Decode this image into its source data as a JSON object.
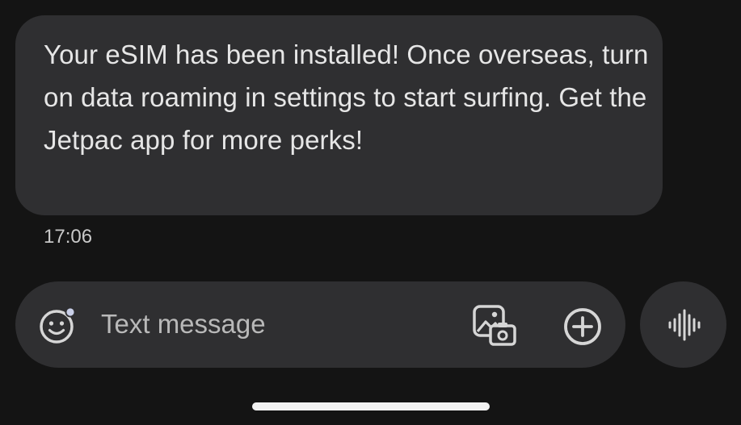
{
  "conversation": {
    "messages": [
      {
        "text": "Your eSIM has been installed! Once overseas, turn on data roaming in settings to start surfing. Get the Jetpac app for more perks!",
        "time": "17:06"
      }
    ]
  },
  "composer": {
    "placeholder": "Text message",
    "value": ""
  },
  "icons": {
    "emoji": "emoji-smile-icon",
    "gallery": "gallery-camera-icon",
    "add": "plus-circle-icon",
    "voice": "voice-waveform-icon"
  },
  "colors": {
    "background": "#141414",
    "bubble": "#2f2f31",
    "text": "#e6e6e6",
    "muted": "#c8c8c8"
  }
}
